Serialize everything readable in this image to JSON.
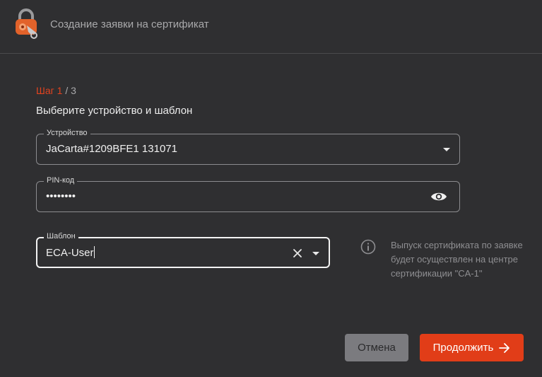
{
  "header": {
    "title": "Создание заявки на сертификат",
    "logo_icon": "lock-key-logo-icon"
  },
  "step": {
    "label": "Шаг",
    "current": "1",
    "total": "/ 3"
  },
  "subtitle": "Выберите устройство и шаблон",
  "form": {
    "device": {
      "label": "Устройство",
      "value": "JaCarta#1209BFE1 131071"
    },
    "pin": {
      "label": "PIN-код",
      "value": "••••••••"
    },
    "template": {
      "label": "Шаблон",
      "value": "ECA-User"
    }
  },
  "info": {
    "text": "Выпуск сертификата по заявке будет осуществлен на центре сертификации \"CA-1\""
  },
  "buttons": {
    "cancel": "Отмена",
    "continue": "Продолжить"
  },
  "colors": {
    "accent": "#e13d18",
    "background": "#2f2f31"
  }
}
